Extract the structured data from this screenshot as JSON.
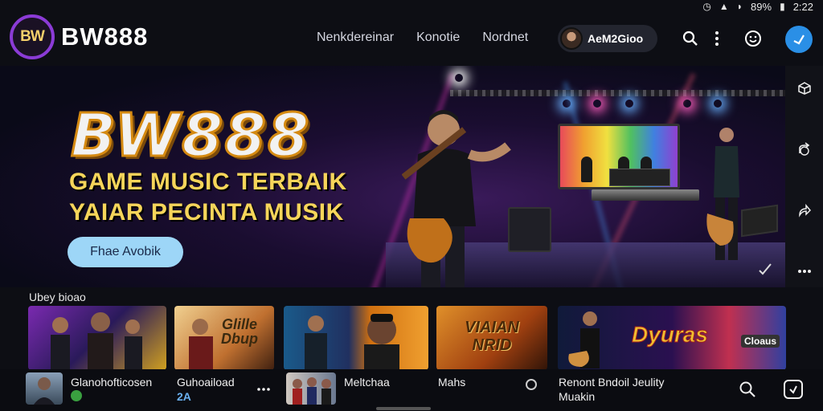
{
  "status": {
    "battery": "89%",
    "time": "2:22"
  },
  "header": {
    "logo_badge": "BW",
    "logo_text": "BW888",
    "nav": [
      "Nenkdereinar",
      "Konotie",
      "Nordnet"
    ],
    "user_name": "AeM2Gioo"
  },
  "hero": {
    "title": "BW888",
    "line1": "GAME MUSIC TERBAIK",
    "line2": "YAIAR PECINTA MUSIK",
    "cta": "Fhae Avobik"
  },
  "section": {
    "title": "Ubey bioao"
  },
  "cards": [
    {
      "text": ""
    },
    {
      "text": "Glille Dbup"
    },
    {
      "text": ""
    },
    {
      "text": "VIAIAN NRID"
    },
    {
      "text": "Dyuras",
      "sub": "Cloaus"
    }
  ],
  "bottom": {
    "item1": "Glanohofticosen",
    "item2_line1": "Guhoaiload",
    "item2_line2": "2A",
    "item3": "Meltchaa",
    "item4": "Mahs",
    "item5_line1": "Renont Bndoil Jeulity",
    "item5_line2": "Muakin"
  },
  "icons": {
    "search": "search-icon",
    "more": "more-vertical-icon",
    "smile": "smiley-icon",
    "bird": "bird-icon"
  }
}
